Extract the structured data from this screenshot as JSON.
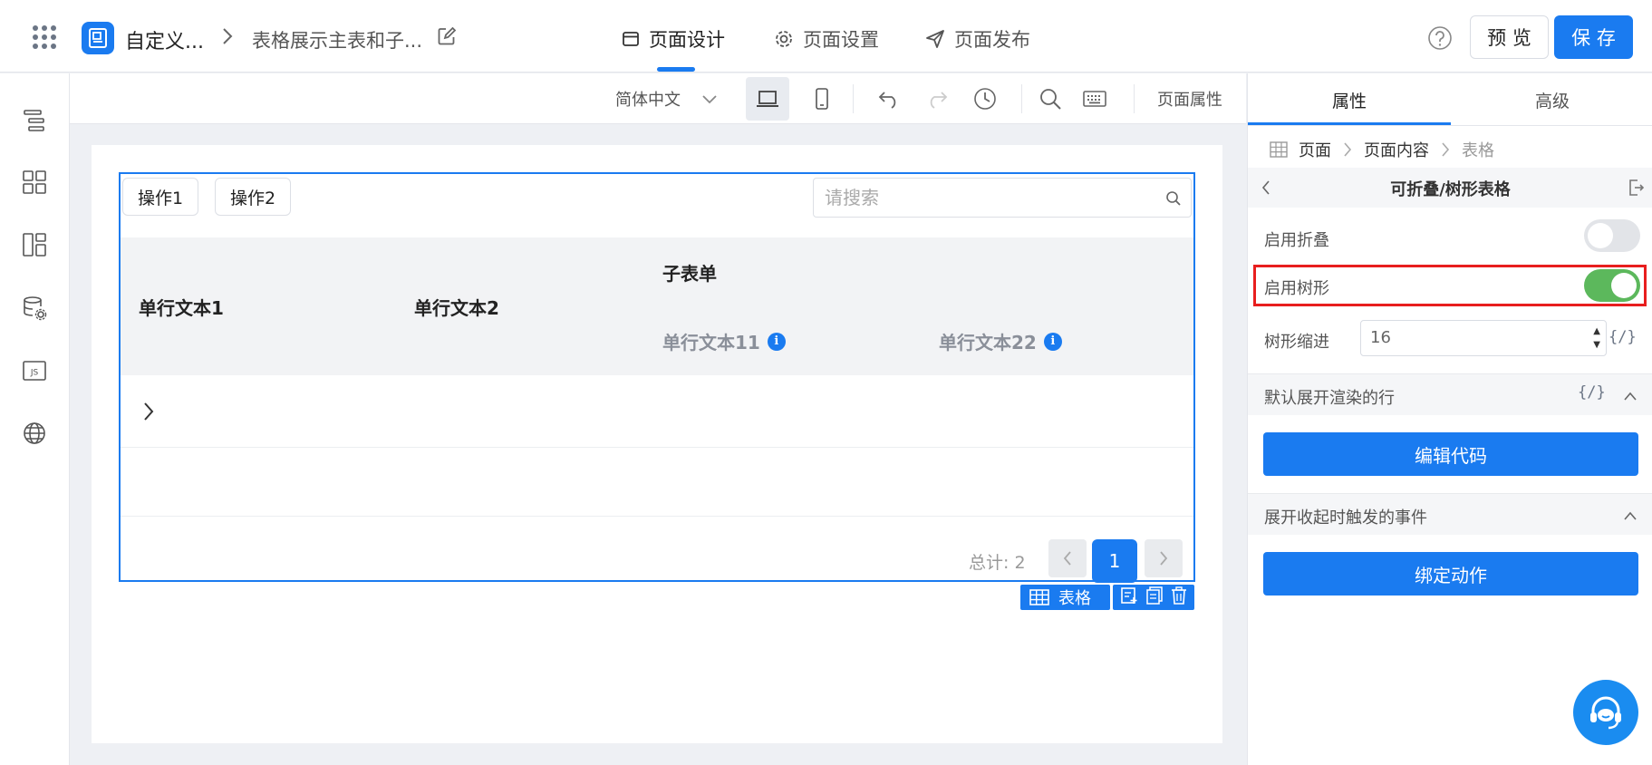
{
  "header": {
    "app_name": "自定义...",
    "page_name": "表格展示主表和子...",
    "tabs": [
      {
        "label": "页面设计"
      },
      {
        "label": "页面设置"
      },
      {
        "label": "页面发布"
      }
    ],
    "preview_label": "预 览",
    "save_label": "保 存",
    "accent_color": "#1a7bf0"
  },
  "toolbar": {
    "language": "简体中文",
    "page_properties": "页面属性"
  },
  "table": {
    "actions": [
      "操作1",
      "操作2"
    ],
    "search_placeholder": "请搜索",
    "columns": {
      "col1": "单行文本1",
      "col2": "单行文本2",
      "group": "子表单",
      "sub1": "单行文本11",
      "sub2": "单行文本22"
    },
    "info_glyph": "i",
    "pager": {
      "total": "总计: 2",
      "current_page": "1"
    },
    "selection_tag": "表格"
  },
  "panel": {
    "tabs": [
      "属性",
      "高级"
    ],
    "breadcrumb": [
      "页面",
      "页面内容",
      "表格"
    ],
    "title": "可折叠/树形表格",
    "enable_collapse_label": "启用折叠",
    "enable_collapse": false,
    "enable_tree_label": "启用树形",
    "enable_tree": true,
    "tree_indent_label": "树形缩进",
    "tree_indent_value": "16",
    "code_token": "{/}",
    "default_expand_label": "默认展开渲染的行",
    "edit_code_label": "编辑代码",
    "toggle_event_label": "展开收起时触发的事件",
    "bind_action_label": "绑定动作",
    "toggle_on_color": "#5cb85c",
    "toggle_off_color": "#e2e4e8"
  }
}
